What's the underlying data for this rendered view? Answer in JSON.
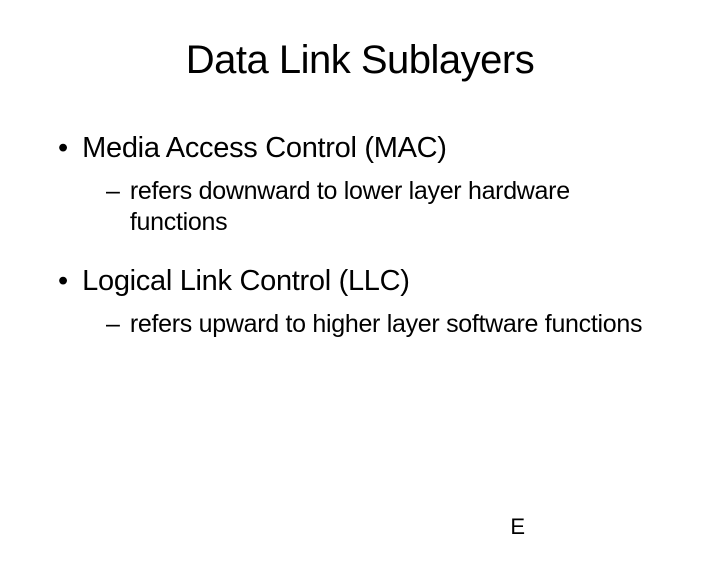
{
  "title": "Data Link Sublayers",
  "bullets": [
    {
      "marker": "•",
      "text": "Media Access Control (MAC)",
      "sub": {
        "marker": "–",
        "text": "refers downward to lower layer hardware functions"
      }
    },
    {
      "marker": "•",
      "text": "Logical Link Control (LLC)",
      "sub": {
        "marker": "–",
        "text": "refers upward to higher layer software functions"
      }
    }
  ],
  "footer": "E"
}
